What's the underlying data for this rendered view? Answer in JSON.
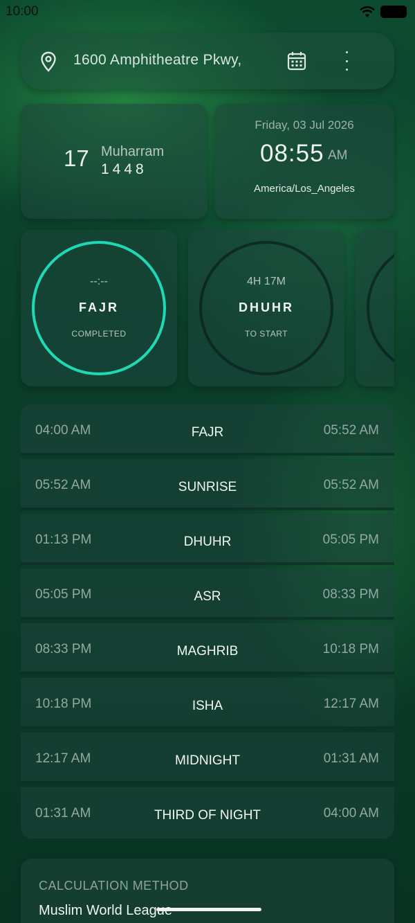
{
  "status_bar": {
    "time": "10:00"
  },
  "location": {
    "address": "1600 Amphitheatre Pkwy,"
  },
  "hijri": {
    "day": "17",
    "month": "Muharram",
    "year": "1448"
  },
  "gregorian": {
    "date": "Friday, 03 Jul 2026",
    "time": "08:55",
    "ampm": "AM",
    "timezone": "America/Los_Angeles"
  },
  "cards": [
    {
      "top": "--:--",
      "name": "FAJR",
      "status": "COMPLETED",
      "progress": 1.0
    },
    {
      "top": "4H 17M",
      "name": "DHUHR",
      "status": "TO START",
      "progress": 0
    }
  ],
  "times": [
    {
      "start": "04:00 AM",
      "name": "FAJR",
      "end": "05:52 AM"
    },
    {
      "start": "05:52 AM",
      "name": "SUNRISE",
      "end": "05:52 AM"
    },
    {
      "start": "01:13 PM",
      "name": "DHUHR",
      "end": "05:05 PM"
    },
    {
      "start": "05:05 PM",
      "name": "ASR",
      "end": "08:33 PM"
    },
    {
      "start": "08:33 PM",
      "name": "MAGHRIB",
      "end": "10:18 PM"
    },
    {
      "start": "10:18 PM",
      "name": "ISHA",
      "end": "12:17 AM"
    },
    {
      "start": "12:17 AM",
      "name": "MIDNIGHT",
      "end": "01:31 AM"
    },
    {
      "start": "01:31 AM",
      "name": "THIRD OF NIGHT",
      "end": "04:00 AM"
    }
  ],
  "calculation": {
    "label": "CALCULATION METHOD",
    "value": "Muslim World League"
  },
  "colors": {
    "accent": "#1fd8b6",
    "background": "#0b3f2a"
  }
}
